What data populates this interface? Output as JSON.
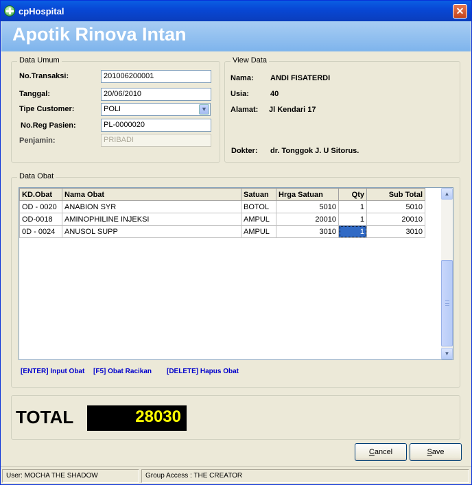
{
  "window": {
    "title": "cpHospital",
    "close_glyph": "✕"
  },
  "header": {
    "title": "Apotik Rinova Intan"
  },
  "data_umum": {
    "legend": "Data Umum",
    "no_transaksi_label": "No.Transaksi:",
    "no_transaksi_value": "201006200001",
    "tanggal_label": "Tanggal:",
    "tanggal_value": "20/06/2010",
    "tipe_customer_label": "Tipe Customer:",
    "tipe_customer_value": "POLI",
    "no_reg_label": "No.Reg Pasien:",
    "no_reg_value": "PL-0000020",
    "penjamin_label": "Penjamin:",
    "penjamin_value": "PRIBADI"
  },
  "view_data": {
    "legend": "View Data",
    "nama_label": "Nama:",
    "nama_value": "ANDI FISATERDI",
    "usia_label": "Usia:",
    "usia_value": "40",
    "alamat_label": "Alamat:",
    "alamat_value": "Jl Kendari 17",
    "dokter_label": "Dokter:",
    "dokter_value": "dr. Tonggok J. U Sitorus."
  },
  "data_obat": {
    "legend": "Data Obat",
    "columns": [
      "KD.Obat",
      "Nama Obat",
      "Satuan",
      "Hrga Satuan",
      "Qty",
      "Sub Total"
    ],
    "rows": [
      [
        "OD - 0020",
        "ANABION SYR",
        "BOTOL",
        "5010",
        "1",
        "5010"
      ],
      [
        "OD-0018",
        "AMINOPHILINE INJEKSI",
        "AMPUL",
        "20010",
        "1",
        "20010"
      ],
      [
        "0D - 0024",
        "ANUSOL SUPP",
        "AMPUL",
        "3010",
        "1",
        "3010"
      ]
    ],
    "hint_input": "[ENTER] Input Obat",
    "hint_racikan": "[F5] Obat Racikan",
    "hint_hapus": "[DELETE] Hapus Obat"
  },
  "total": {
    "label": "TOTAL",
    "value": "28030"
  },
  "buttons": {
    "cancel_first": "C",
    "cancel_rest": "ancel",
    "save_first": "S",
    "save_rest": "ave"
  },
  "status": {
    "user": "User: MOCHA THE SHADOW",
    "group": "Group Access : THE CREATOR"
  },
  "icons": {
    "app": "app-cross-icon",
    "combo": "chevron-down-icon",
    "scroll_up": "scroll-up-icon",
    "scroll_down": "scroll-down-icon"
  },
  "colors": {
    "header_bg": "#7eb4ec",
    "total_bg": "#000000",
    "total_fg": "#ffff00",
    "hint_fg": "#0000cc",
    "selection": "#316ac5"
  }
}
